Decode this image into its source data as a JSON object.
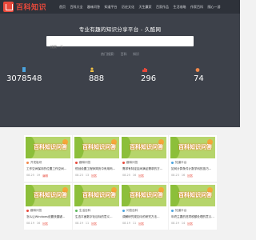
{
  "header": {
    "logo_text": "百科知识",
    "nav": [
      "首页",
      "百科大全",
      "趣味问答",
      "知道平台",
      "历史文化",
      "天生赢家",
      "百家作品",
      "生活攻略",
      "作家百科",
      "随心一游"
    ]
  },
  "hero": {
    "title": "专业有趣的知识分享平台 - 久酷网",
    "search_placeholder": "搜索一下",
    "hot_label": "热门搜索:",
    "hot_terms": [
      "百科",
      "知识"
    ]
  },
  "stats": [
    {
      "value": "3078548",
      "icon": "document-icon",
      "color": "#4aa3df"
    },
    {
      "value": "888",
      "icon": "user-icon",
      "color": "#f6c344"
    },
    {
      "value": "296",
      "icon": "chart-icon",
      "color": "#e8493b"
    },
    {
      "value": "74",
      "icon": "drop-icon",
      "color": "#f2884b"
    }
  ],
  "thumb_text": "百科知识问答",
  "cards": [
    {
      "cat": "开发板块",
      "cat_color": "#f2884b",
      "title": "工作空间保存的位置工作空间...",
      "date": "08-25",
      "count": "19",
      "tag": "编辑"
    },
    {
      "cat": "趣味问答",
      "cat_color": "#e8493b",
      "title": "恒创设置工程师简历中有用吗...",
      "date": "08-23",
      "count": "13",
      "tag": "回答"
    },
    {
      "cat": "趣味问答",
      "cat_color": "#e8493b",
      "title": "需求有特定区间满足需求的方...",
      "date": "08-25",
      "count": "16",
      "tag": "回答"
    },
    {
      "cat": "知道平台",
      "cat_color": "#4aa3df",
      "title": "如何计算条件计数学科的技巧...",
      "date": "08-23",
      "count": "16",
      "tag": "回答"
    },
    {
      "cat": "趣味问答",
      "cat_color": "#e8493b",
      "title": "怎么让Windows设置快捷键...",
      "date": "08-19",
      "count": "16",
      "tag": "回答"
    },
    {
      "cat": "生活百科",
      "cat_color": "#5cb85c",
      "title": "生态平面数字化目标的意义...",
      "date": "08-19",
      "count": "11",
      "tag": "回答"
    },
    {
      "cat": "问答百科",
      "cat_color": "#4aa3df",
      "title": "调解研究现如今的研究方法...",
      "date": "08-19",
      "count": "11",
      "tag": "回答"
    },
    {
      "cat": "知道平台",
      "cat_color": "#4aa3df",
      "title": "年终主要的进项税额处理的意义...",
      "date": "08-19",
      "count": "14",
      "tag": "回答"
    }
  ]
}
